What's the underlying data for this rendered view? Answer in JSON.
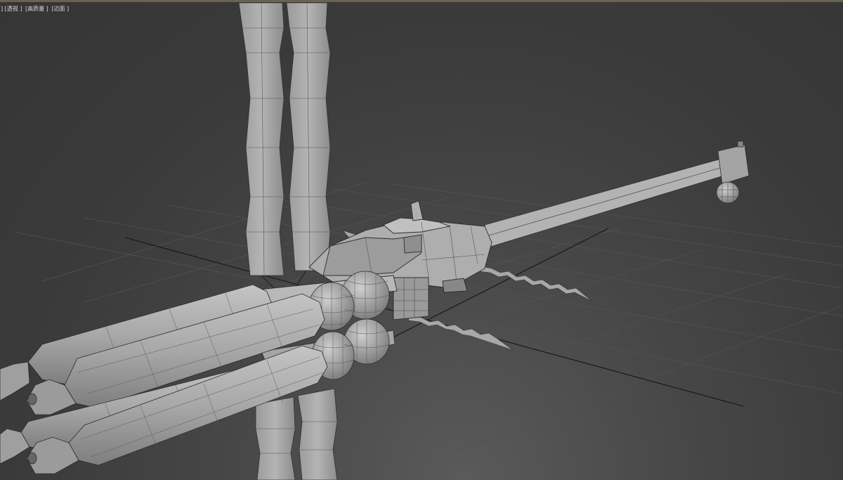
{
  "viewport": {
    "labels": [
      "] [透视 ]",
      "[高质量 ]",
      "[边面 ]"
    ],
    "background": "#474747",
    "model_color": "#a9a9a9",
    "wire_color": "#2f2f2f",
    "grid_color": "#4f4f4f"
  },
  "icons": {
    "model": "spaceship-wireframe-model"
  }
}
